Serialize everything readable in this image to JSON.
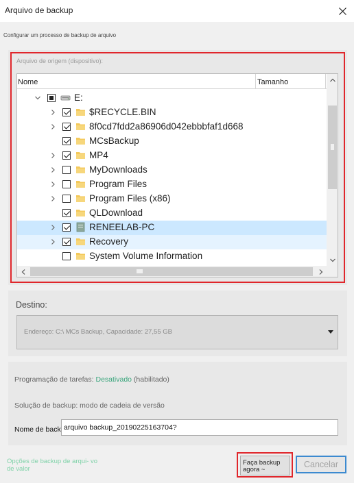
{
  "window": {
    "title": "Arquivo de backup"
  },
  "subtitle": "Configurar um processo de backup de arquivo",
  "source": {
    "label": "Arquivo de origem (dispositivo):",
    "columns": {
      "name": "Nome",
      "size": "Tamanho"
    },
    "rows": [
      {
        "label": "E:",
        "level": 0,
        "expander": "expanded",
        "check": "partial",
        "icon": "drive-icon",
        "state": ""
      },
      {
        "label": "$RECYCLE.BIN",
        "level": 1,
        "expander": "collapsed",
        "check": "checked",
        "icon": "folder-icon",
        "state": ""
      },
      {
        "label": "8f0cd7fdd2a86906d042ebbbfaf1d668",
        "level": 1,
        "expander": "collapsed",
        "check": "checked",
        "icon": "folder-icon",
        "state": ""
      },
      {
        "label": "MCsBackup",
        "level": 1,
        "expander": "none",
        "check": "checked",
        "icon": "folder-icon",
        "state": ""
      },
      {
        "label": "MP4",
        "level": 1,
        "expander": "collapsed",
        "check": "checked",
        "icon": "folder-icon",
        "state": ""
      },
      {
        "label": "MyDownloads",
        "level": 1,
        "expander": "collapsed",
        "check": "unchecked",
        "icon": "folder-icon",
        "state": ""
      },
      {
        "label": "Program Files",
        "level": 1,
        "expander": "collapsed",
        "check": "unchecked",
        "icon": "folder-icon",
        "state": ""
      },
      {
        "label": "Program Files (x86)",
        "level": 1,
        "expander": "collapsed",
        "check": "unchecked",
        "icon": "folder-icon",
        "state": ""
      },
      {
        "label": "QLDownload",
        "level": 1,
        "expander": "none",
        "check": "checked",
        "icon": "folder-icon",
        "state": ""
      },
      {
        "label": "RENEELAB-PC",
        "level": 1,
        "expander": "collapsed",
        "check": "checked",
        "icon": "folder-icon",
        "state": "selected"
      },
      {
        "label": "Recovery",
        "level": 1,
        "expander": "collapsed",
        "check": "checked",
        "icon": "folder-icon",
        "state": "hover"
      },
      {
        "label": "System Volume Information",
        "level": 1,
        "expander": "none",
        "check": "unchecked",
        "icon": "folder-icon",
        "state": ""
      }
    ]
  },
  "destination": {
    "label": "Destino:",
    "value": "Endereço: C:\\ MCs Backup, Capacidade: 27,55 GB"
  },
  "options": {
    "schedule_label": "Programação de tarefas: ",
    "schedule_value": "Desativado",
    "schedule_suffix": " (habilitado)",
    "scheme": "Solução de backup: modo de cadeia de versão",
    "name_label": "Nome de backup:",
    "name_value": "arquivo backup_20190225163704?"
  },
  "footer": {
    "options_link": "Opções de backup de arqui- vo de valor",
    "backup_now": "Faça backup agora ~",
    "cancel": "Cancelar"
  },
  "colors": {
    "accent": "#e0262b",
    "highlight": "#cce8ff",
    "link": "#7fd2a8",
    "focus": "#3c8ad0",
    "folder": "#f4c95b"
  }
}
